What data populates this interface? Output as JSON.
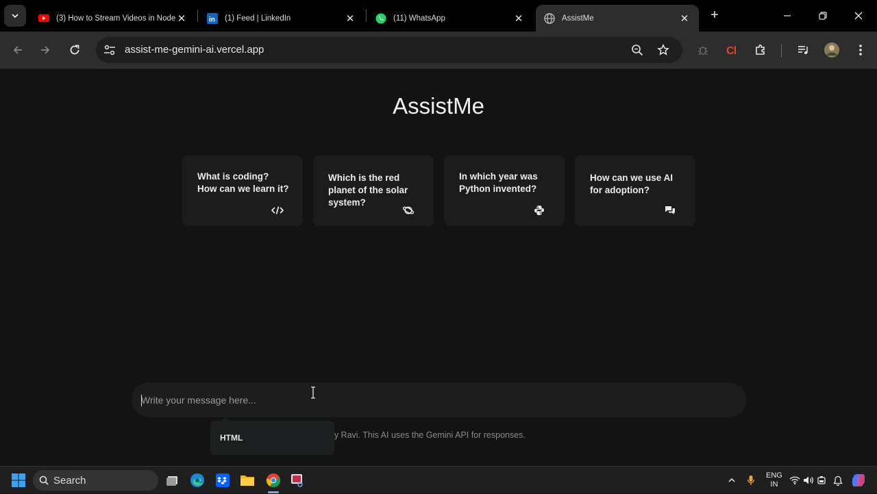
{
  "browser": {
    "tabs": [
      {
        "title": "(3) How to Stream Videos in Nodejs",
        "icon": "youtube-icon"
      },
      {
        "title": "(1) Feed | LinkedIn",
        "icon": "linkedin-icon"
      },
      {
        "title": "(11) WhatsApp",
        "icon": "whatsapp-icon"
      },
      {
        "title": "AssistMe",
        "icon": "globe-icon",
        "active": true
      }
    ],
    "url": "assist-me-gemini-ai.vercel.app"
  },
  "app": {
    "title": "AssistMe",
    "cards": [
      {
        "text": "What is coding? How can we learn it?",
        "icon": "code-icon"
      },
      {
        "text": "Which is the red planet of the solar system?",
        "icon": "planet-icon"
      },
      {
        "text": "In which year was Python invented?",
        "icon": "python-icon"
      },
      {
        "text": "How can we use AI for adoption?",
        "icon": "chat-icon"
      }
    ],
    "input_placeholder": "Write your message here...",
    "footer_note": "s developed by Ravi. This AI uses the Gemini API for responses.",
    "tooltip": "HTML"
  },
  "taskbar": {
    "search_label": "Search",
    "language_line1": "ENG",
    "language_line2": "IN"
  },
  "colors": {
    "page_bg": "#131313",
    "card_bg": "#1c1c1c",
    "toolbar_bg": "#2d2d2d"
  }
}
